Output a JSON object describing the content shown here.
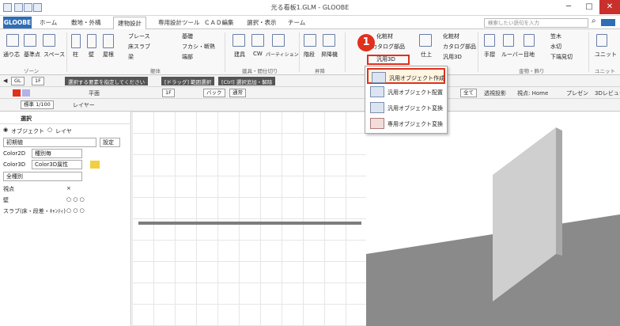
{
  "window": {
    "title": "光る看板1.GLM - GLOOBE",
    "minimize": "─",
    "maximize": "□",
    "close": "✕"
  },
  "tabs": {
    "file": "GLOOBE",
    "items": [
      "ホーム",
      "敷地・外構",
      "建物設計",
      "専用設計ツール",
      "ＣＡＤ編集",
      "選択・表示",
      "チーム"
    ],
    "search_placeholder": "検索したい語句を入力",
    "search_icon_text": "⌕"
  },
  "ribbon": {
    "row1": [
      "通り芯",
      "基準点",
      "スペース",
      "柱",
      "壁",
      "屋根"
    ],
    "brace": "ブレース",
    "slab": "床スラブ",
    "beam": "梁",
    "foundation": "基礎",
    "curtain": "フカシ・断熱",
    "edge": "端部",
    "fixture": "建具",
    "cw": "CW",
    "partition": "パーティション",
    "stairs": "階段",
    "elevator": "昇降機",
    "finish_item": "化粧材",
    "catalog": "カタログ部品",
    "use3d": "汎用3D",
    "finish": "仕上",
    "finish_item2": "化粧材",
    "catalog2": "カタログ部品",
    "use3d2": "汎用3D",
    "handrail": "手摺",
    "louver": "ルーバー",
    "joint": "目地",
    "baseboard": "笠木",
    "watercut": "水切",
    "drip": "下端見切",
    "unit": "ユニット",
    "groups": [
      "ゾーン",
      "躯体",
      "建具・間仕切り",
      "昇降",
      "金物・飾り",
      "ユニット"
    ]
  },
  "toolbar1": {
    "gl": "GL",
    "floor": "1F",
    "hint1": "選択する要素を指定してください",
    "hint2": "[ドラッグ] 範囲選択",
    "hint3": "[Ctrl] 選択追加・解除"
  },
  "toolbar2": {
    "plan": "平面",
    "floor": "1F",
    "back": "バック",
    "normal": "通常",
    "tab_full": "全て",
    "perspective": "透視投影",
    "viewpoint": "視点: Home",
    "present": "プレゼン",
    "view3d": "3Dレビュー"
  },
  "toolbar3": {
    "scale": "標準 1/100",
    "layer": "レイヤー"
  },
  "dropdown": {
    "items": [
      "汎用オブジェクト作成",
      "汎用オブジェクト配置",
      "汎用オブジェクト変換",
      "専用オブジェクト変換"
    ]
  },
  "step_badge": "1",
  "left_panel": {
    "title": "選択",
    "mode_object": "オブジェクト",
    "mode_layer": "レイヤ",
    "preset": "初期値",
    "settings": "設定",
    "color2d_label": "Color2D",
    "color2d_value": "種別毎",
    "color3d_label": "Color3D",
    "color3d_value": "Color3D属性",
    "all_types": "全種別",
    "rows": [
      {
        "label": "視点",
        "marks": "×"
      },
      {
        "label": "壁",
        "marks": "○ ○ ○"
      },
      {
        "label": "スラブ(床・段差・ｷｬﾝﾃｨ)",
        "marks": "○ ○ ○"
      }
    ]
  },
  "colors": {
    "accent": "#e0301e",
    "file_tab": "#2f6db5",
    "dropdown_highlight": "#fff5e0"
  }
}
